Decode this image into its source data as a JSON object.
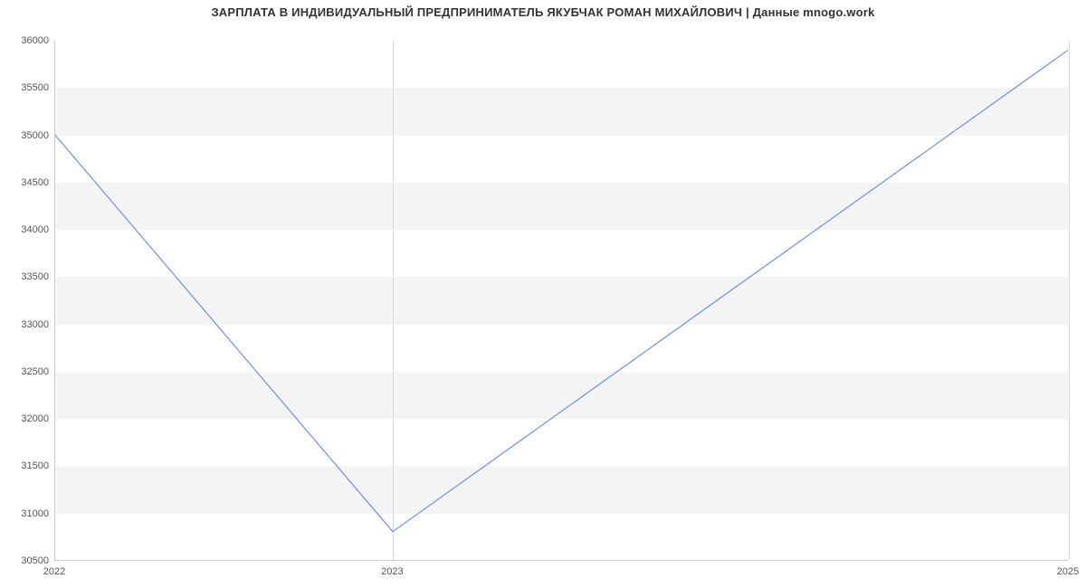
{
  "chart_data": {
    "type": "line",
    "title": "ЗАРПЛАТА В ИНДИВИДУАЛЬНЫЙ ПРЕДПРИНИМАТЕЛЬ ЯКУБЧАК РОМАН МИХАЙЛОВИЧ | Данные mnogo.work",
    "x": [
      2022,
      2023,
      2025
    ],
    "values": [
      35000,
      30800,
      35900
    ],
    "x_ticks": [
      2022,
      2023,
      2025
    ],
    "y_ticks": [
      30500,
      31000,
      31500,
      32000,
      32500,
      33000,
      33500,
      34000,
      34500,
      35000,
      35500,
      36000
    ],
    "xlabel": "",
    "ylabel": "",
    "xlim": [
      2022,
      2025
    ],
    "ylim": [
      30500,
      36000
    ]
  },
  "colors": {
    "line": "#6f8fe0",
    "band": "#f4f4f4",
    "axis": "#c9c9c9"
  }
}
